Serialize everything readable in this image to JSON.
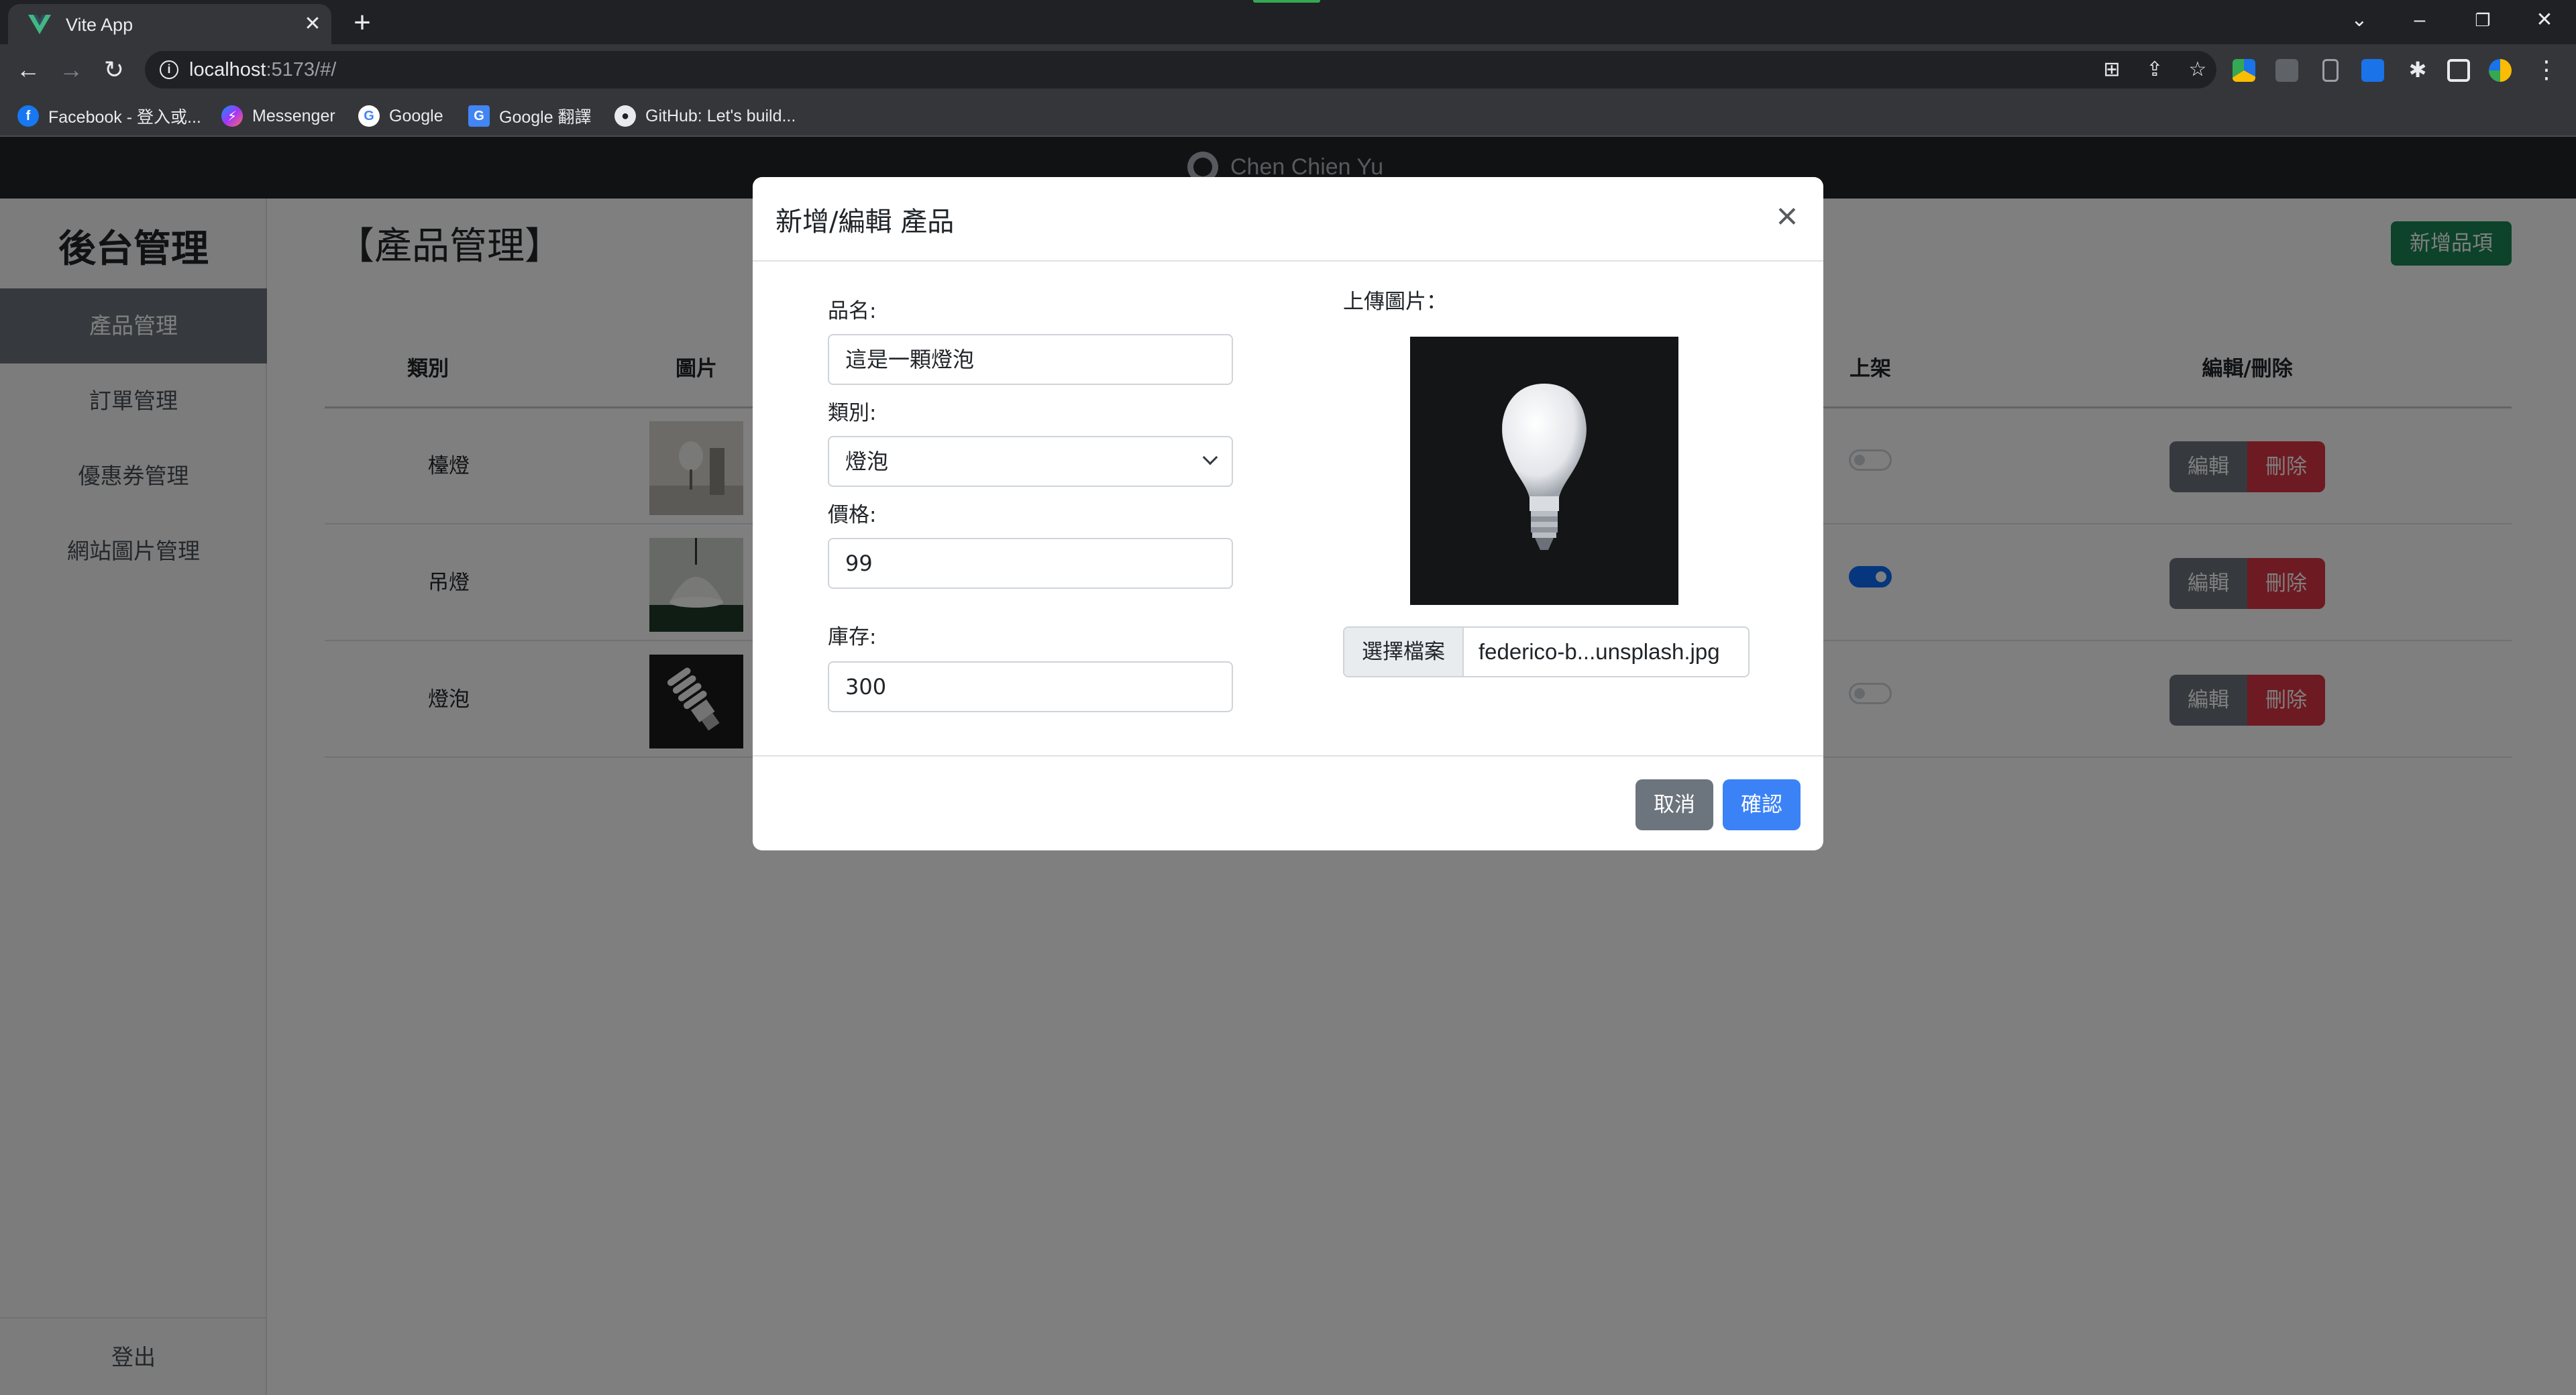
{
  "browser": {
    "tab_title": "Vite App",
    "url_host": "localhost",
    "url_rest": ":5173/#/",
    "bookmarks": [
      {
        "label": "Facebook - 登入或...",
        "icon": "facebook-icon"
      },
      {
        "label": "Messenger",
        "icon": "messenger-icon"
      },
      {
        "label": "Google",
        "icon": "google-icon"
      },
      {
        "label": "Google 翻譯",
        "icon": "google-translate-icon"
      },
      {
        "label": "GitHub: Let's build...",
        "icon": "github-icon"
      }
    ]
  },
  "page": {
    "topbar_brand": "Chen Chien Yu",
    "sidebar": {
      "title": "後台管理",
      "items": [
        {
          "label": "產品管理",
          "active": true
        },
        {
          "label": "訂單管理",
          "active": false
        },
        {
          "label": "優惠券管理",
          "active": false
        },
        {
          "label": "網站圖片管理",
          "active": false
        }
      ],
      "logout": "登出"
    },
    "main_title": "【產品管理】",
    "add_button": "新增品項",
    "table": {
      "headers": {
        "category": "類別",
        "image": "圖片",
        "published": "上架",
        "actions": "編輯/刪除"
      },
      "rows": [
        {
          "category": "檯燈",
          "published": false,
          "edit": "編輯",
          "delete": "刪除"
        },
        {
          "category": "吊燈",
          "published": true,
          "edit": "編輯",
          "delete": "刪除"
        },
        {
          "category": "燈泡",
          "published": false,
          "edit": "編輯",
          "delete": "刪除"
        }
      ]
    }
  },
  "modal": {
    "title": "新增/編輯 產品",
    "name_label": "品名:",
    "name_value": "這是一顆燈泡",
    "category_label": "類別:",
    "category_value": "燈泡",
    "price_label": "價格:",
    "price_value": "99",
    "stock_label": "庫存:",
    "stock_value": "300",
    "upload_label": "上傳圖片：",
    "file_button": "選擇檔案",
    "file_name": "federico-b...unsplash.jpg",
    "cancel": "取消",
    "confirm": "確認"
  },
  "colors": {
    "topbar": "#212529",
    "primary": "#0d6efd",
    "success": "#198754",
    "danger": "#dc3545",
    "secondary": "#6c757d"
  }
}
